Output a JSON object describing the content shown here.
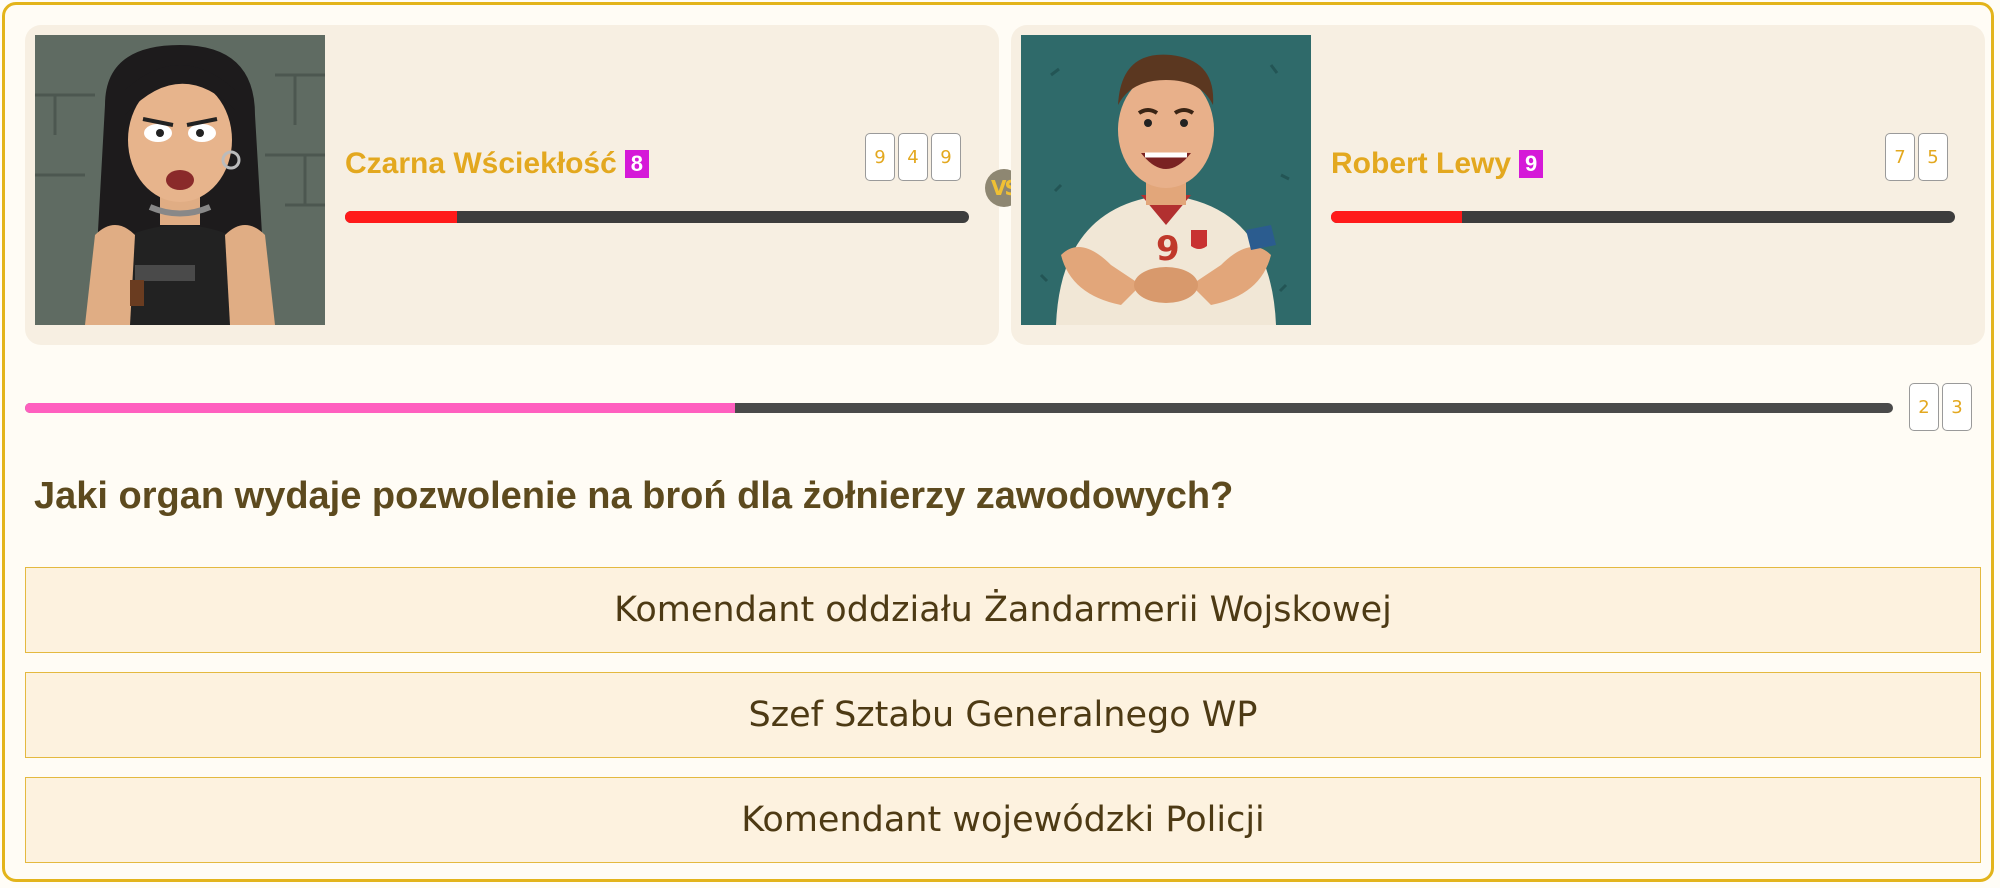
{
  "player1": {
    "name": "Czarna Wściekłość",
    "level": "8",
    "scores": [
      "9",
      "4",
      "9"
    ],
    "hp_fraction": 0.18
  },
  "player2": {
    "name": "Robert Lewy",
    "level": "9",
    "scores": [
      "7",
      "5"
    ],
    "hp_fraction": 0.21
  },
  "vs_label": "VS",
  "progress": {
    "fraction": 0.38,
    "round_scores": [
      "2",
      "3"
    ]
  },
  "question": "Jaki organ wydaje pozwolenie na broń dla żołnierzy zawodowych?",
  "answers": [
    "Komendant oddziału Żandarmerii Wojskowej",
    "Szef Sztabu Generalnego WP",
    "Komendant wojewódzki Policji"
  ],
  "colors": {
    "accent": "#e3b41b",
    "name_color": "#e3a81f",
    "level_badge": "#d519d8",
    "hp_fill": "#ff1a1a",
    "progress_fill": "#ff5fbf"
  }
}
